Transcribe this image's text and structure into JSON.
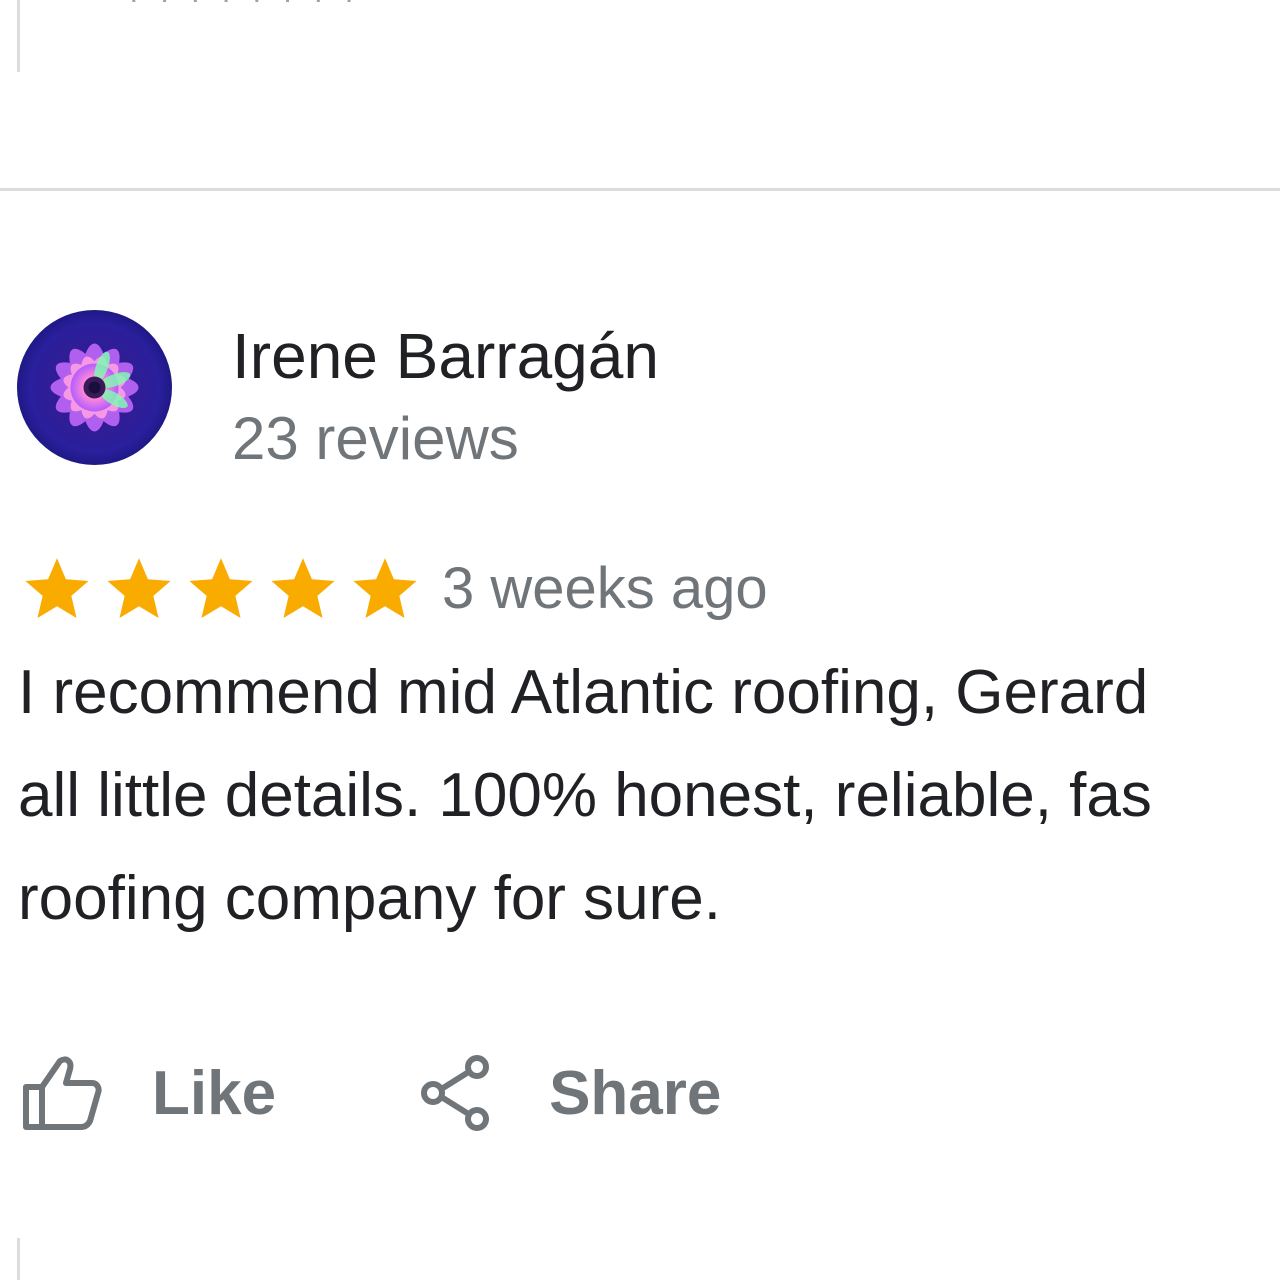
{
  "previous_review": {
    "partial_text": "' ' ' '   ' ' ' '"
  },
  "review": {
    "reviewer": {
      "name": "Irene Barragán",
      "review_count": "23 reviews",
      "avatar_icon": "flower-avatar"
    },
    "rating": {
      "value": 5,
      "max": 5,
      "star_icon": "star-icon",
      "star_color": "#f9ab00"
    },
    "timestamp": "3 weeks ago",
    "text_lines": [
      "I recommend mid Atlantic roofing, Gerard",
      "all little details. 100% honest, reliable, fas",
      "roofing company for sure."
    ],
    "actions": {
      "like": {
        "label": "Like",
        "icon": "thumb-up-icon"
      },
      "share": {
        "label": "Share",
        "icon": "share-icon"
      }
    }
  },
  "colors": {
    "text_primary": "#202124",
    "text_secondary": "#70757a",
    "divider": "#dadce0",
    "star": "#f9ab00"
  }
}
